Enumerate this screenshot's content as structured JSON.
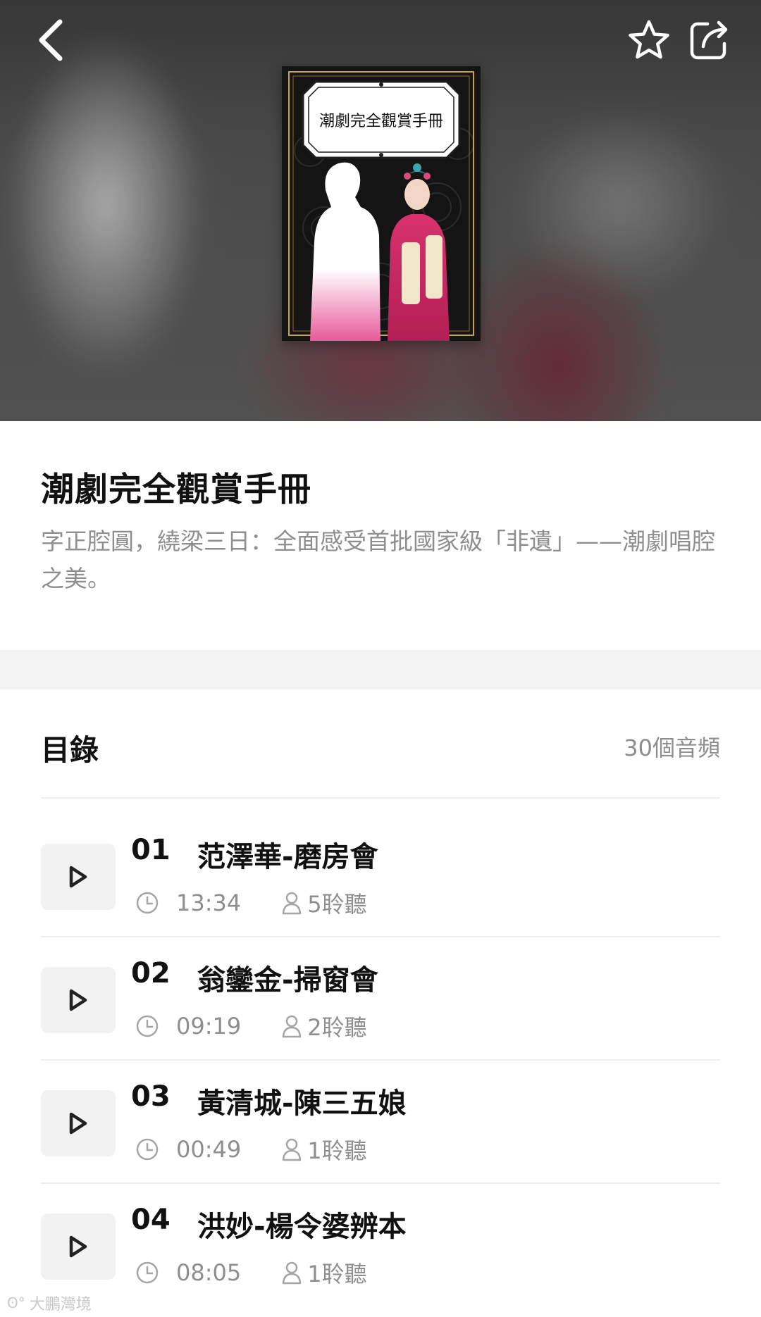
{
  "header": {
    "back_icon": "chevron-left-icon",
    "favorite_icon": "star-outline-icon",
    "share_icon": "share-icon"
  },
  "cover": {
    "text": "潮劇完全觀賞手冊"
  },
  "album": {
    "title": "潮劇完全觀賞手冊",
    "description": "字正腔圓，繞梁三日：全面感受首批國家級「非遺」——潮劇唱腔之美。"
  },
  "catalog": {
    "title": "目錄",
    "count": "30個音頻",
    "tracks": [
      {
        "number": "01",
        "name": "范澤華-磨房會",
        "duration": "13:34",
        "listens": "5聆聽"
      },
      {
        "number": "02",
        "name": "翁鑾金-掃窗會",
        "duration": "09:19",
        "listens": "2聆聽"
      },
      {
        "number": "03",
        "name": "黃清城-陳三五娘",
        "duration": "00:49",
        "listens": "1聆聽"
      },
      {
        "number": "04",
        "name": "洪妙-楊令婆辨本",
        "duration": "08:05",
        "listens": "1聆聽"
      }
    ]
  },
  "watermark": {
    "text": "大鵬灣境"
  },
  "colors": {
    "secondary_text": "#8e8e8e",
    "divider": "#efefef",
    "section_gap": "#f4f4f5",
    "play_button_bg": "#f2f2f3"
  }
}
